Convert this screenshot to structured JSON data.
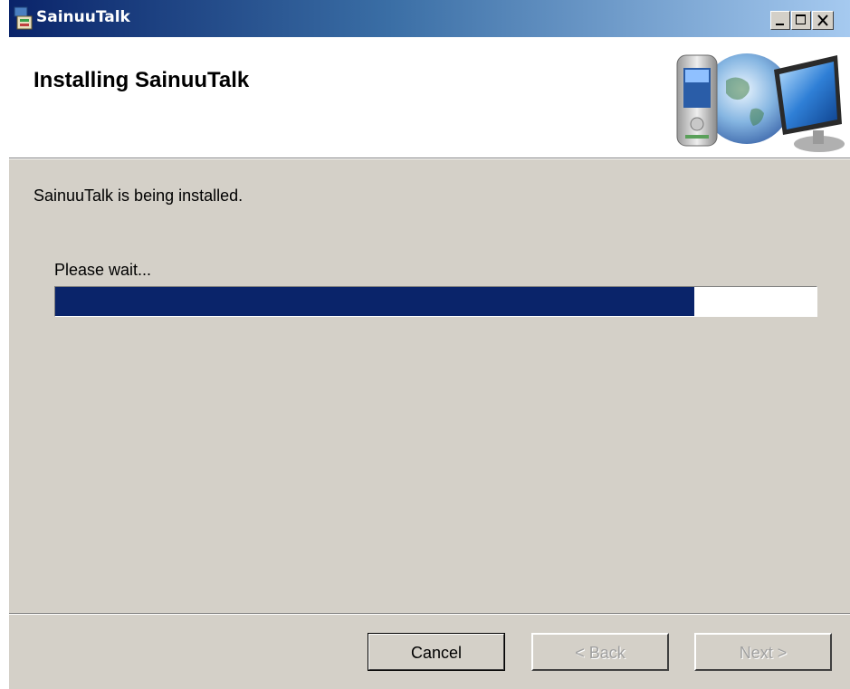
{
  "window": {
    "title": "SainuuTalk"
  },
  "header": {
    "title": "Installing SainuuTalk",
    "graphic_icon": "pda-globe-monitor-icon"
  },
  "body": {
    "status_text": "SainuuTalk is being installed.",
    "progress_label": "Please wait...",
    "progress_fraction": 0.84
  },
  "buttons": {
    "cancel": "Cancel",
    "back": "< Back",
    "next": "Next >"
  },
  "colors": {
    "titlebar_start": "#0a246a",
    "titlebar_end": "#a6caf0",
    "progress_fill": "#0a246a",
    "dialog_bg": "#d4d0c8"
  }
}
